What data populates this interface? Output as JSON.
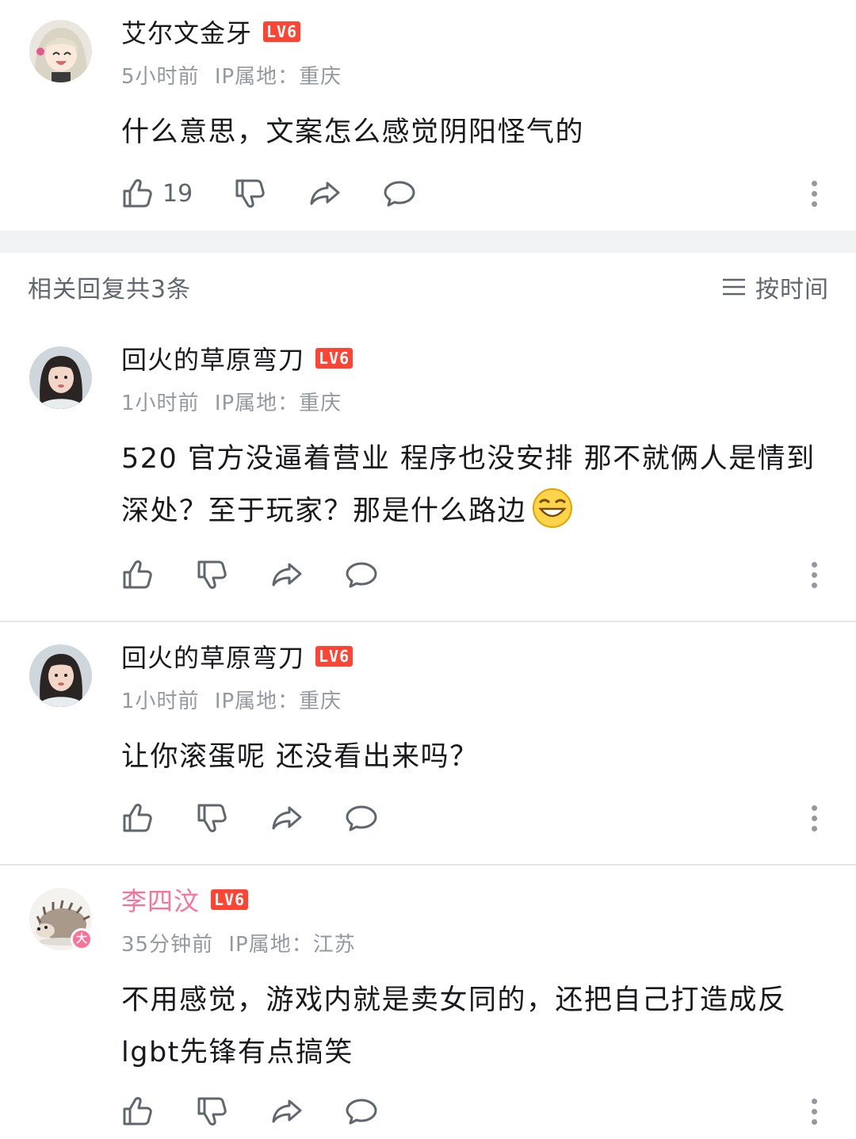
{
  "main_comment": {
    "username": "艾尔文金牙",
    "level": "LV6",
    "time": "5小时前",
    "ip": "IP属地：重庆",
    "text": "什么意思，文案怎么感觉阴阳怪气的",
    "likes": "19"
  },
  "replies_header": {
    "title": "相关回复共3条",
    "sort_label": "按时间"
  },
  "replies": [
    {
      "username": "回火的草原弯刀",
      "level": "LV6",
      "time": "1小时前",
      "ip": "IP属地：重庆",
      "text": "520 官方没逼着营业 程序也没安排 那不就俩人是情到深处？至于玩家？那是什么路边"
    },
    {
      "username": "回火的草原弯刀",
      "level": "LV6",
      "time": "1小时前",
      "ip": "IP属地：重庆",
      "text": "让你滚蛋呢 还没看出来吗？"
    },
    {
      "username": "李四汶",
      "level": "LV6",
      "time": "35分钟前",
      "ip": "IP属地：江苏",
      "badge": "大",
      "text": "不用感觉，游戏内就是卖女同的，还把自己打造成反lgbt先锋有点搞笑"
    }
  ],
  "icons": {
    "like": "thumbs-up-icon",
    "dislike": "thumbs-down-icon",
    "share": "share-icon",
    "reply": "comment-bubble-icon",
    "more": "more-vertical-icon",
    "sort": "menu-lines-icon",
    "emoji": "grinning-face-emoji"
  },
  "colors": {
    "level_badge": "#ff4433",
    "vip_name": "#fb7299",
    "meta_text": "#9499a0",
    "separator": "#f1f2f3"
  }
}
